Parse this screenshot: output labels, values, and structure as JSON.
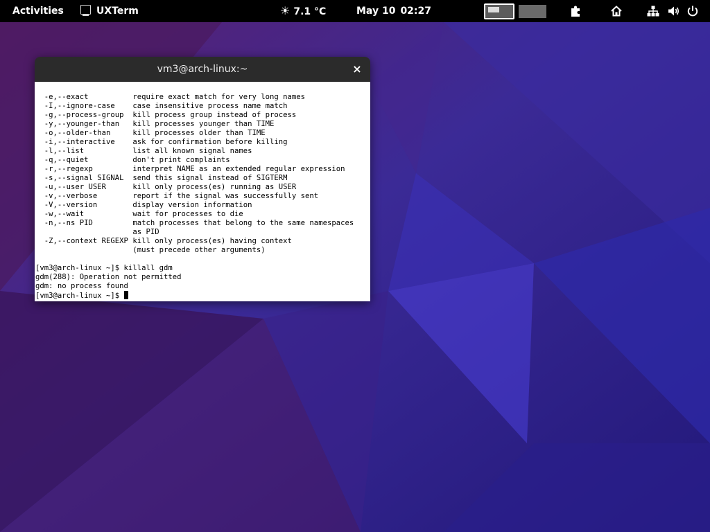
{
  "topbar": {
    "activities": "Activities",
    "app_name": "UXTerm",
    "app_icon": "terminal-icon",
    "weather_icon": "sun-icon",
    "temperature": "7.1 °C",
    "date": "May 10",
    "time": "02:27",
    "system_icons": [
      "extensions-icon",
      "home-icon",
      "network-icon",
      "volume-icon",
      "power-icon"
    ]
  },
  "window": {
    "title": "vm3@arch-linux:~",
    "close_label": "×"
  },
  "terminal": {
    "lines": [
      "  -e,--exact          require exact match for very long names",
      "  -I,--ignore-case    case insensitive process name match",
      "  -g,--process-group  kill process group instead of process",
      "  -y,--younger-than   kill processes younger than TIME",
      "  -o,--older-than     kill processes older than TIME",
      "  -i,--interactive    ask for confirmation before killing",
      "  -l,--list           list all known signal names",
      "  -q,--quiet          don't print complaints",
      "  -r,--regexp         interpret NAME as an extended regular expression",
      "  -s,--signal SIGNAL  send this signal instead of SIGTERM",
      "  -u,--user USER      kill only process(es) running as USER",
      "  -v,--verbose        report if the signal was successfully sent",
      "  -V,--version        display version information",
      "  -w,--wait           wait for processes to die",
      "  -n,--ns PID         match processes that belong to the same namespaces",
      "                      as PID",
      "  -Z,--context REGEXP kill only process(es) having context",
      "                      (must precede other arguments)",
      "",
      "[vm3@arch-linux ~]$ killall gdm",
      "gdm(288): Operation not permitted",
      "gdm: no process found"
    ],
    "prompt": "[vm3@arch-linux ~]$ "
  },
  "colors": {
    "topbar_bg": "#000000",
    "wallpaper_base": "#3a1f78",
    "terminal_bg": "#ffffff",
    "titlebar_bg": "#2b2b2b"
  }
}
